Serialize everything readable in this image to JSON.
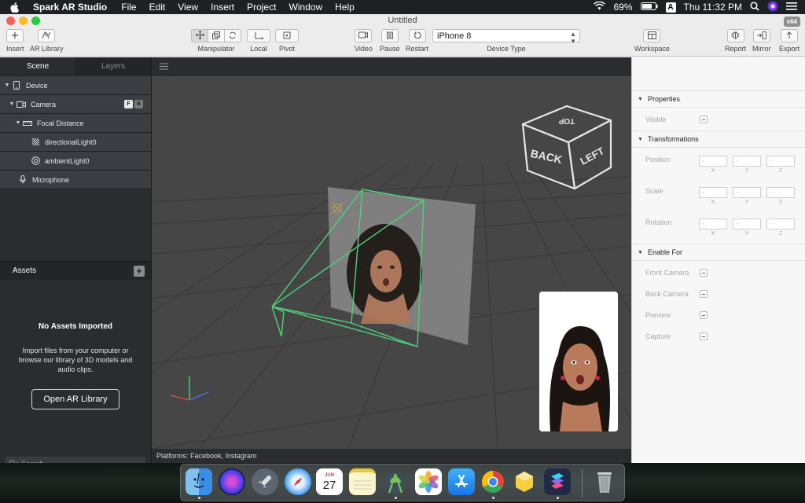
{
  "menubar": {
    "app_name": "Spark AR Studio",
    "menus": [
      "File",
      "Edit",
      "View",
      "Insert",
      "Project",
      "Window",
      "Help"
    ],
    "battery": "69%",
    "input_source": "A",
    "clock": "Thu 11:32 PM"
  },
  "window": {
    "title": "Untitled",
    "version_badge": "v64"
  },
  "toolbar": {
    "insert_label": "Insert",
    "ar_library_label": "AR Library",
    "manipulator_label": "Manipulator",
    "local_label": "Local",
    "pivot_label": "Pivot",
    "video_label": "Video",
    "pause_label": "Pause",
    "restart_label": "Restart",
    "device_value": "iPhone 8",
    "device_type_label": "Device Type",
    "workspace_label": "Workspace",
    "report_label": "Report",
    "mirror_label": "Mirror",
    "export_label": "Export"
  },
  "left_panel": {
    "tabs": [
      "Scene",
      "Layers"
    ],
    "scene_items": [
      {
        "label": "Device",
        "icon": "phone-icon"
      },
      {
        "label": "Camera",
        "icon": "video-camera-icon",
        "badges": [
          "F",
          "B"
        ]
      },
      {
        "label": "Focal Distance",
        "icon": "ruler-icon"
      },
      {
        "label": "directionalLight0",
        "icon": "directional-light-icon"
      },
      {
        "label": "ambientLight0",
        "icon": "ambient-light-icon"
      },
      {
        "label": "Microphone",
        "icon": "microphone-icon"
      }
    ],
    "assets_title": "Assets",
    "assets_empty_title": "No Assets Imported",
    "assets_empty_desc": "Import files from your computer or browse our library of 3D models and audio clips.",
    "open_library_label": "Open AR Library",
    "search_placeholder": "Search"
  },
  "viewport": {
    "cube_back": "BACK",
    "cube_left": "LEFT",
    "cube_top": "TOP",
    "status": "Platforms: Facebook, Instagram"
  },
  "right_panel": {
    "properties_title": "Properties",
    "visible_label": "Visible",
    "transformations_title": "Transformations",
    "position_label": "Position",
    "scale_label": "Scale",
    "rotation_label": "Rotation",
    "placeholder": "-",
    "axes": [
      "X",
      "Y",
      "Z"
    ],
    "enable_for_title": "Enable For",
    "front_camera_label": "Front Camera",
    "back_camera_label": "Back Camera",
    "preview_label": "Preview",
    "capture_label": "Capture"
  },
  "dock": {
    "calendar_month": "JUN",
    "calendar_day": "27"
  }
}
